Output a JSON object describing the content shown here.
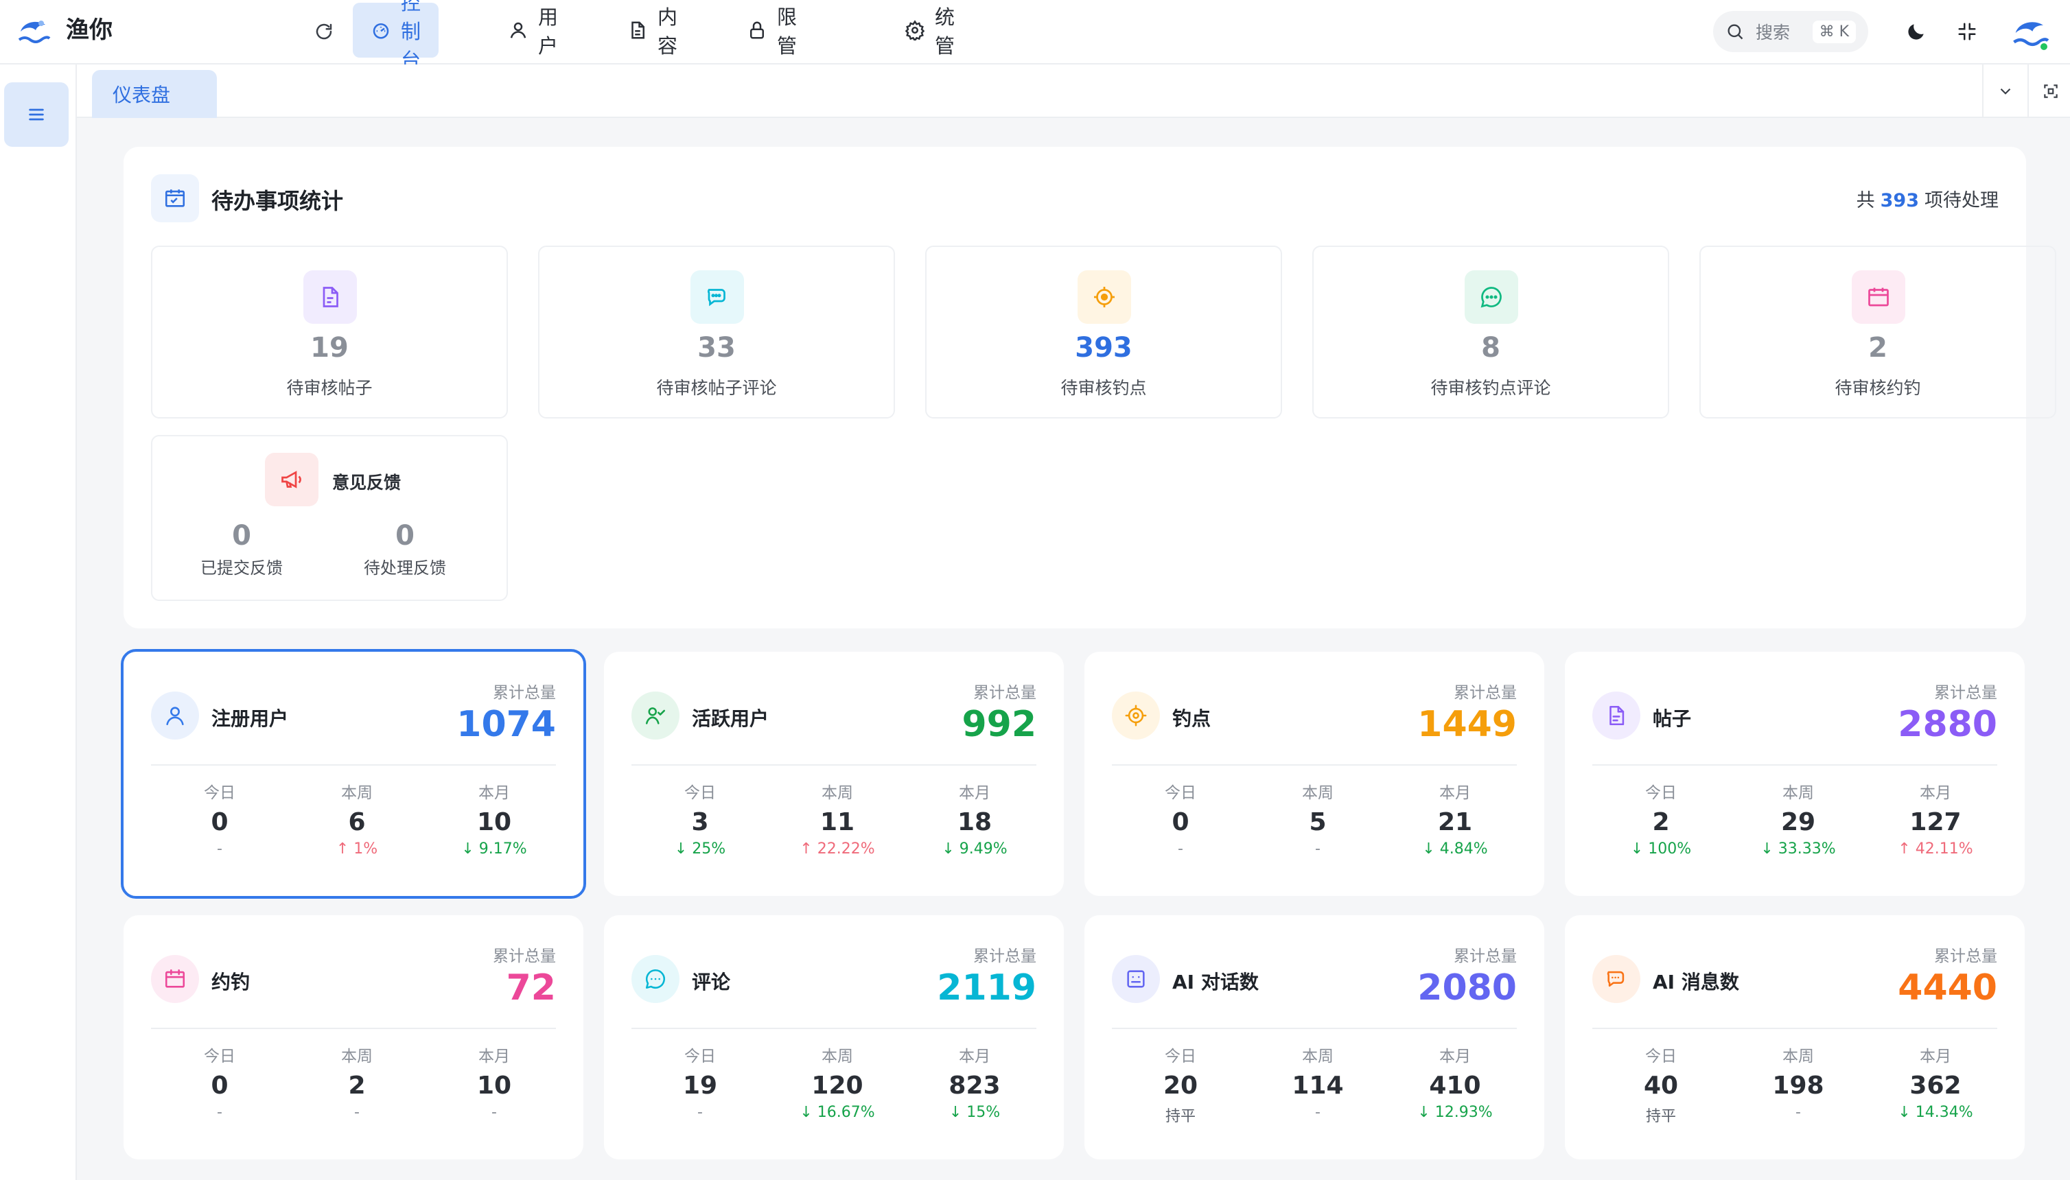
{
  "app": {
    "title": "渔你"
  },
  "nav": {
    "items": [
      {
        "label": "控制台",
        "icon": "dashboard-icon"
      },
      {
        "label": "用户",
        "icon": "user-icon"
      },
      {
        "label": "内容",
        "icon": "document-icon"
      },
      {
        "label": "权限管理",
        "icon": "lock-icon"
      },
      {
        "label": "系统管理",
        "icon": "gear-icon"
      }
    ],
    "active": "控制台"
  },
  "search": {
    "placeholder": "搜索",
    "shortcut": "⌘ K"
  },
  "tabs": [
    {
      "label": "仪表盘"
    }
  ],
  "todo": {
    "title": "待办事项统计",
    "total_prefix": "共",
    "total": "393",
    "total_suffix": "项待处理",
    "cards": [
      {
        "value": "19",
        "label": "待审核帖子",
        "icon": "post-icon",
        "color": "#8b5cf6"
      },
      {
        "value": "33",
        "label": "待审核帖子评论",
        "icon": "comment-icon",
        "color": "#06b6d4"
      },
      {
        "value": "393",
        "label": "待审核钓点",
        "icon": "target-icon",
        "color": "#f59e0b"
      },
      {
        "value": "8",
        "label": "待审核钓点评论",
        "icon": "chat-icon",
        "color": "#10b981"
      },
      {
        "value": "2",
        "label": "待审核约钓",
        "icon": "calendar-icon",
        "color": "#ec4899"
      }
    ],
    "feedback": {
      "title": "意见反馈",
      "submitted_value": "0",
      "submitted_label": "已提交反馈",
      "pending_value": "0",
      "pending_label": "待处理反馈"
    }
  },
  "stats": [
    {
      "name": "注册用户",
      "total_label": "累计总量",
      "total": "1074",
      "color": "#3479ea",
      "today": "0",
      "today_change": "-",
      "week": "6",
      "week_change": "↑ 1%",
      "month": "10",
      "month_change": "↓ 9.17%"
    },
    {
      "name": "活跃用户",
      "total_label": "累计总量",
      "total": "992",
      "color": "#16a34a",
      "today": "3",
      "today_change": "↓ 25%",
      "week": "11",
      "week_change": "↑ 22.22%",
      "month": "18",
      "month_change": "↓ 9.49%"
    },
    {
      "name": "钓点",
      "total_label": "累计总量",
      "total": "1449",
      "color": "#f59e0b",
      "today": "0",
      "today_change": "-",
      "week": "5",
      "week_change": "-",
      "month": "21",
      "month_change": "↓ 4.84%"
    },
    {
      "name": "帖子",
      "total_label": "累计总量",
      "total": "2880",
      "color": "#8b5cf6",
      "today": "2",
      "today_change": "↓ 100%",
      "week": "29",
      "week_change": "↓ 33.33%",
      "month": "127",
      "month_change": "↑ 42.11%"
    },
    {
      "name": "约钓",
      "total_label": "累计总量",
      "total": "72",
      "color": "#ec4899",
      "today": "0",
      "today_change": "-",
      "week": "2",
      "week_change": "-",
      "month": "10",
      "month_change": "-"
    },
    {
      "name": "评论",
      "total_label": "累计总量",
      "total": "2119",
      "color": "#06b6d4",
      "today": "19",
      "today_change": "-",
      "week": "120",
      "week_change": "↓ 16.67%",
      "month": "823",
      "month_change": "↓ 15%"
    },
    {
      "name": "AI 对话数",
      "total_label": "累计总量",
      "total": "2080",
      "color": "#6366f1",
      "today": "20",
      "today_change": "持平",
      "week": "114",
      "week_change": "-",
      "month": "410",
      "month_change": "↓ 12.93%"
    },
    {
      "name": "AI 消息数",
      "total_label": "累计总量",
      "total": "4440",
      "color": "#f97316",
      "today": "40",
      "today_change": "持平",
      "week": "198",
      "week_change": "-",
      "month": "362",
      "month_change": "↓ 14.34%"
    }
  ],
  "period_labels": {
    "today": "今日",
    "week": "本周",
    "month": "本月"
  }
}
